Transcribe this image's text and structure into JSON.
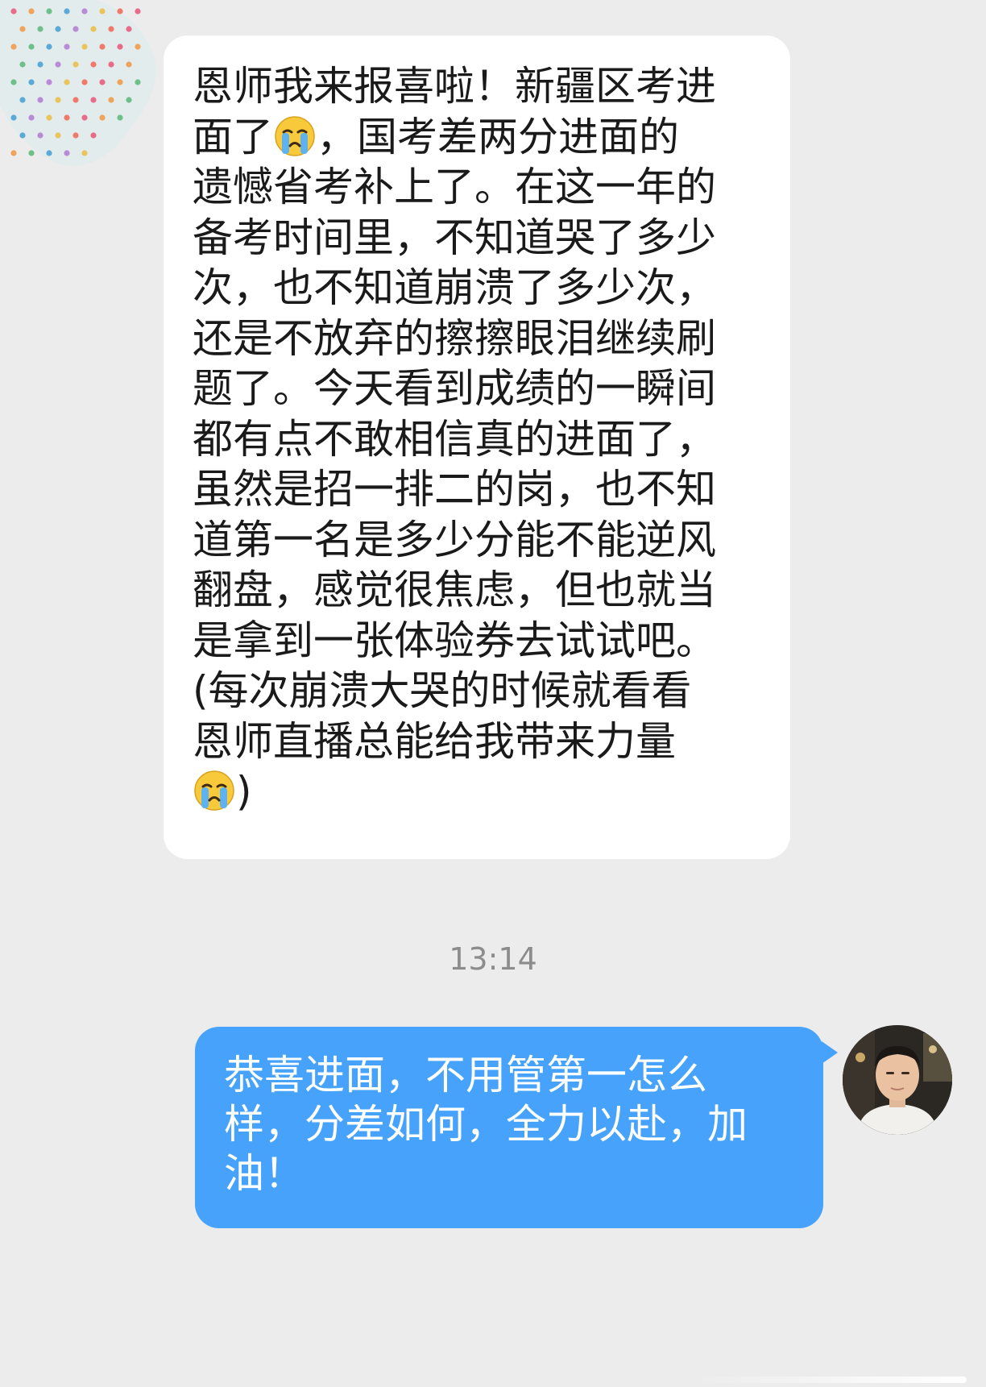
{
  "incoming": {
    "lines": [
      "恩师我来报喜啦！新疆区考进",
      "面了",
      "，国考差两分进面的",
      "遗憾省考补上了。在这一年的",
      "备考时间里，不知道哭了多少",
      "次，也不知道崩溃了多少次，",
      "还是不放弃的擦擦眼泪继续刷",
      "题了。今天看到成绩的一瞬间",
      "都有点不敢相信真的进面了，",
      "虽然是招一排二的岗，也不知",
      "道第一名是多少分能不能逆风",
      "翻盘，感觉很焦虑，但也就当",
      "是拿到一张体验券去试试吧。",
      "(每次崩溃大哭的时候就看看",
      "恩师直播总能给我带来力量",
      ")"
    ],
    "emoji": "crying-face",
    "bubble_color": "#ffffff"
  },
  "timestamp": "13:14",
  "outgoing": {
    "lines": [
      "恭喜进面，不用管第一怎么",
      "样，分差如何，全力以赴，加",
      "油！"
    ],
    "bubble_color": "#46a2fb"
  },
  "colors": {
    "background": "#ececec",
    "text": "#1a1a1a",
    "timestamp": "#8c8c8c"
  }
}
